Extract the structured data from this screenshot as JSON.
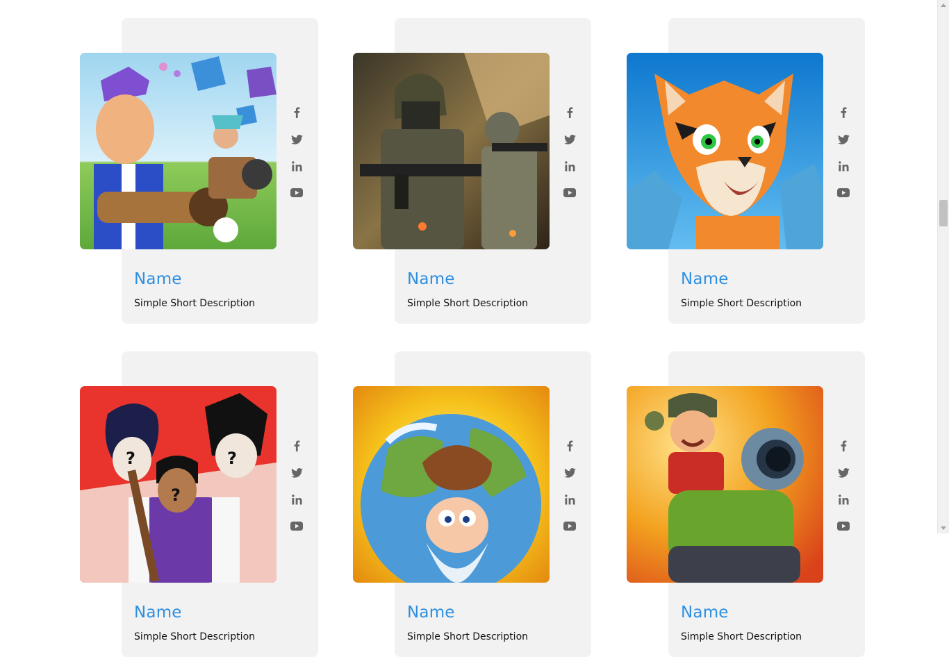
{
  "cards": [
    {
      "name": "Name",
      "description": "Simple Short Description",
      "image": "voxel-hero-game-art",
      "colors": {
        "bg1": "#7ec5ea",
        "bg2": "#b8e2f3",
        "accent": "#7f54c9"
      }
    },
    {
      "name": "Name",
      "description": "Simple Short Description",
      "image": "soldiers-shooter-game-art",
      "colors": {
        "bg1": "#6b5a3b",
        "bg2": "#c9a15f",
        "accent": "#4d4b36"
      }
    },
    {
      "name": "Name",
      "description": "Simple Short Description",
      "image": "tiger-cartoon-game-art",
      "colors": {
        "bg1": "#1e86d6",
        "bg2": "#5ab4ec",
        "accent": "#f18a2b"
      }
    },
    {
      "name": "Name",
      "description": "Simple Short Description",
      "image": "anime-guess-game-art",
      "colors": {
        "bg1": "#e8342c",
        "bg2": "#f4f4f4",
        "accent": "#6c3aa8"
      }
    },
    {
      "name": "Name",
      "description": "Simple Short Description",
      "image": "planet-gnome-game-art",
      "colors": {
        "bg1": "#f6c21b",
        "bg2": "#4d9ad8",
        "accent": "#8a4a22"
      }
    },
    {
      "name": "Name",
      "description": "Simple Short Description",
      "image": "tank-soldier-game-art",
      "colors": {
        "bg1": "#f3a21f",
        "bg2": "#e85a1a",
        "accent": "#69a52c"
      }
    }
  ],
  "social_icons": [
    "facebook-icon",
    "twitter-icon",
    "linkedin-icon",
    "youtube-icon"
  ],
  "theme": {
    "name_color": "#2e8fe0",
    "card_bg": "#f2f2f3",
    "icon_color": "#666666"
  }
}
